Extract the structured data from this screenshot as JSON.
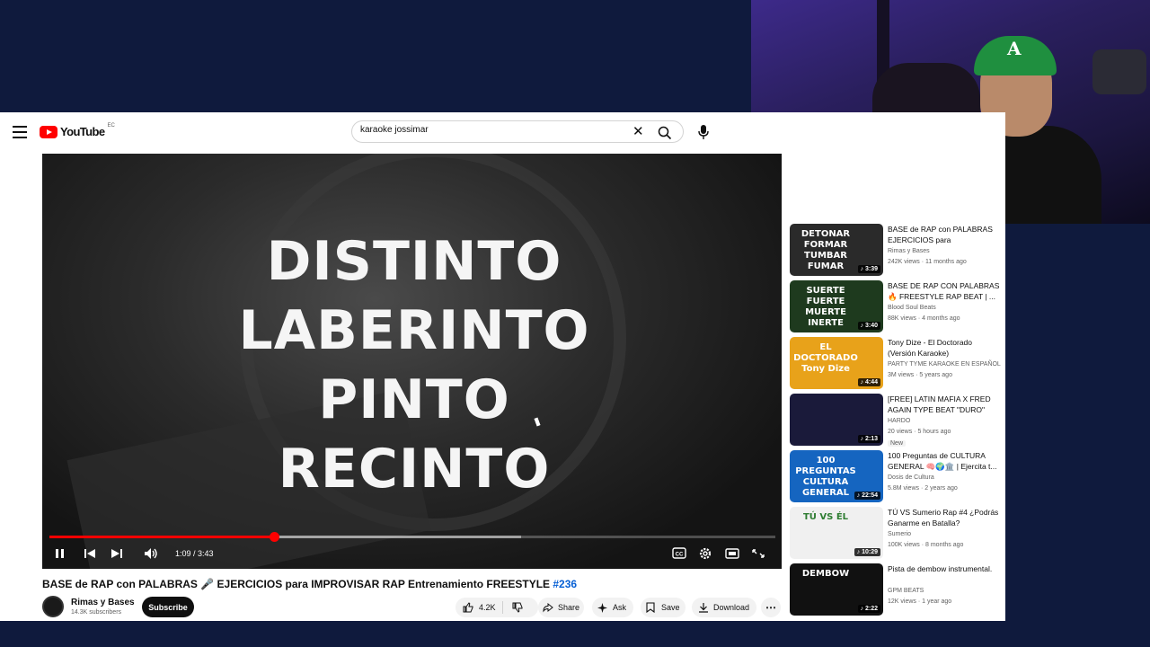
{
  "colors": {
    "background": "#0f1a3d",
    "accent_red": "#ff0000",
    "link_blue": "#065fd4",
    "frame_border": "#6a2f8f"
  },
  "masthead": {
    "logo_text": "YouTube",
    "logo_country": "EC",
    "search_value": "karaoke jossimar",
    "icons": [
      "menu-icon",
      "youtube-logo",
      "clear-icon",
      "search-icon",
      "mic-icon"
    ]
  },
  "player": {
    "lyrics": [
      "DISTINTO",
      "LABERINTO",
      "PINTO",
      "RECINTO"
    ],
    "time": "1:09 / 3:43",
    "progress_fraction": 0.309,
    "buffer_fraction": 0.65,
    "controls": [
      "pause-icon",
      "previous-icon",
      "next-icon",
      "volume-icon",
      "captions-icon",
      "settings-icon",
      "theater-icon",
      "fullscreen-icon"
    ]
  },
  "video": {
    "title": "BASE de RAP con PALABRAS 🎤 EJERCICIOS para IMPROVISAR RAP Entrenamiento FREESTYLE ",
    "hashtag": "#236",
    "channel": {
      "name": "Rimas y Bases",
      "subscribers": "14.3K subscribers",
      "subscribe_label": "Subscribe"
    },
    "actions": {
      "likes": "4.2K",
      "share": "Share",
      "ask": "Ask",
      "save": "Save",
      "download": "Download"
    }
  },
  "related": [
    {
      "thumb_text": "DETONAR FORMAR TUMBAR FUMAR",
      "thumb_color": "#2a2a2a",
      "text_color": "#ffffff",
      "duration": "3:39",
      "title": "BASE de RAP con PALABRAS EJERCICIOS para IMPROVISA...",
      "channel": "Rimas y Bases",
      "meta": "242K views · 11 months ago",
      "badge": ""
    },
    {
      "thumb_text": "SUERTE FUERTE MUERTE INERTE",
      "thumb_color": "#1e3a1e",
      "text_color": "#ffffff",
      "duration": "3:40",
      "title": "BASE DE RAP CON PALABRAS 🔥 FREESTYLE RAP BEAT | ...",
      "channel": "Blood Soul Beats",
      "meta": "88K views · 4 months ago",
      "badge": ""
    },
    {
      "thumb_text": "EL DOCTORADO Tony Dize",
      "thumb_color": "#e8a21a",
      "text_color": "#ffffff",
      "duration": "4:44",
      "title": "Tony Dize - El Doctorado (Versión Karaoke)",
      "channel": "PARTY TYME KARAOKE EN ESPAÑOL",
      "meta": "3M views · 5 years ago",
      "badge": ""
    },
    {
      "thumb_text": "",
      "thumb_color": "#1a1a3a",
      "text_color": "#ffffff",
      "duration": "2:13",
      "title": "[FREE] LATIN MAFIA X FRED AGAIN TYPE BEAT \"DURO\"",
      "channel": "HARDO",
      "meta": "20 views · 5 hours ago",
      "badge": "New"
    },
    {
      "thumb_text": "100 PREGUNTAS CULTURA GENERAL",
      "thumb_color": "#1565c0",
      "text_color": "#ffffff",
      "duration": "22:54",
      "title": "100 Preguntas de CULTURA GENERAL 🧠🌍🏛️ | Ejercita t...",
      "channel": "Dosis de Cultura",
      "meta": "5.8M views · 2 years ago",
      "badge": ""
    },
    {
      "thumb_text": "TÚ VS ÉL",
      "thumb_color": "#f0f0f0",
      "text_color": "#2e7d32",
      "duration": "10:29",
      "title": "TÚ VS Sumerio Rap #4 ¿Podrás Ganarme en Batalla?",
      "channel": "Sumerio",
      "meta": "100K views · 8 months ago",
      "badge": ""
    },
    {
      "thumb_text": "DEMBOW",
      "thumb_color": "#111111",
      "text_color": "#ffffff",
      "duration": "2:22",
      "title": "Pista de dembow instrumental.",
      "channel": "GPM BEATS",
      "meta": "12K views · 1 year ago",
      "badge": ""
    }
  ]
}
